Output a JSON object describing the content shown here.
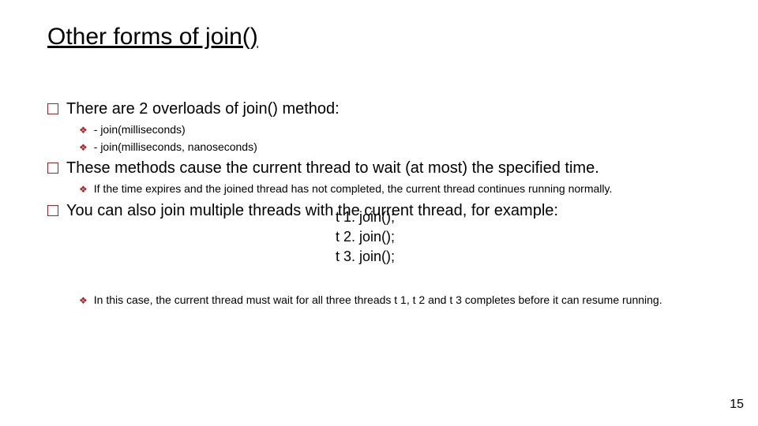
{
  "title": "Other forms of join()",
  "points": {
    "p1": "There are 2 overloads of join() method:",
    "p1_a": "- join(milliseconds)",
    "p1_b": "- join(milliseconds,  nanoseconds)",
    "p2": "These methods cause the current thread to wait (at most) the specified time.",
    "p2_a": "If the time expires and the joined thread has not completed, the current thread continues running normally.",
    "p3": "You can also join multiple threads with the current thread, for example:",
    "code1": "t 1. join();",
    "code2": "t 2. join();",
    "code3": "t 3. join();",
    "p3_a": "In this case, the current thread must wait for all three threads t 1, t 2 and t 3 completes before it can resume running."
  },
  "slide_number": "15"
}
